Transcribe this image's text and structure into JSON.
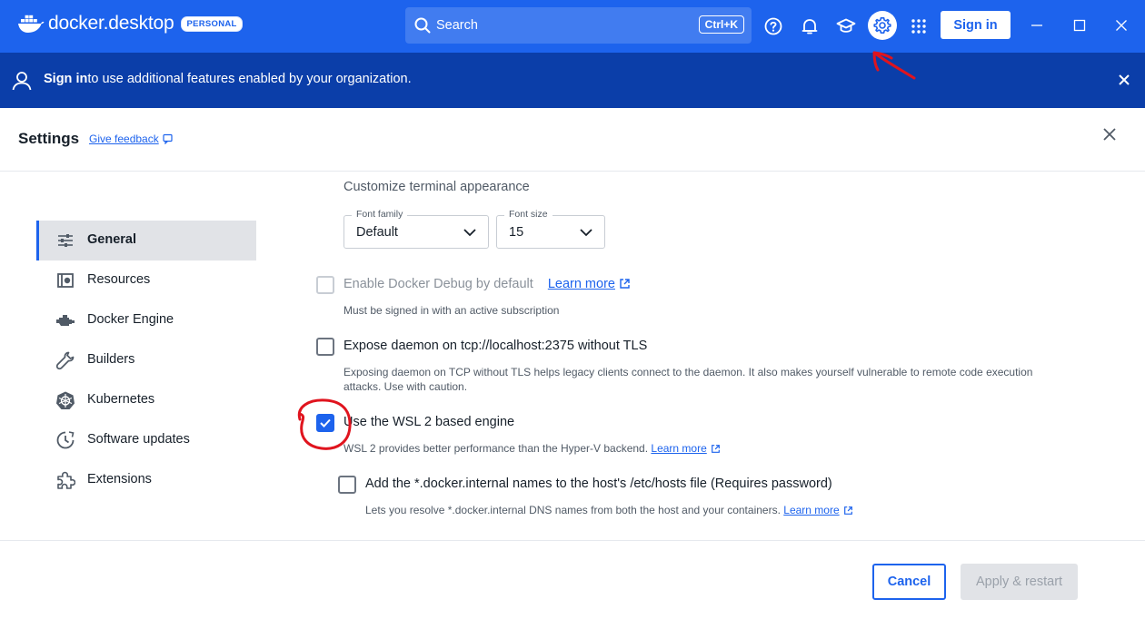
{
  "app": {
    "brand": "docker.desktop",
    "badge": "PERSONAL"
  },
  "topbar": {
    "search_label": "Search",
    "search_shortcut": "Ctrl+K",
    "signin_label": "Sign in",
    "icons": [
      "help-icon",
      "bell-icon",
      "learn-icon",
      "gear-icon",
      "apps-grid-icon"
    ]
  },
  "banner": {
    "signin_link": "Sign in",
    "message": "to use additional features enabled by your organization."
  },
  "settings": {
    "title": "Settings",
    "feedback_label": "Give feedback"
  },
  "sidebar": {
    "items": [
      {
        "label": "General",
        "icon": "sliders-icon",
        "active": true
      },
      {
        "label": "Resources",
        "icon": "resources-icon"
      },
      {
        "label": "Docker Engine",
        "icon": "engine-icon"
      },
      {
        "label": "Builders",
        "icon": "wrench-icon"
      },
      {
        "label": "Kubernetes",
        "icon": "kubernetes-icon"
      },
      {
        "label": "Software updates",
        "icon": "update-clock-icon"
      },
      {
        "label": "Extensions",
        "icon": "puzzle-icon"
      }
    ]
  },
  "general": {
    "terminal_section": "Customize terminal appearance",
    "font_family": {
      "label": "Font family",
      "value": "Default"
    },
    "font_size": {
      "label": "Font size",
      "value": "15"
    },
    "debug": {
      "label": "Enable Docker Debug by default",
      "link": "Learn more",
      "help": "Must be signed in with an active subscription",
      "checked": false,
      "disabled": true
    },
    "expose_daemon": {
      "label": "Expose daemon on tcp://localhost:2375 without TLS",
      "help": "Exposing daemon on TCP without TLS helps legacy clients connect to the daemon. It also makes yourself vulnerable to remote code execution attacks. Use with caution.",
      "checked": false
    },
    "wsl2": {
      "label": "Use the WSL 2 based engine",
      "help": "WSL 2 provides better performance than the Hyper-V backend.",
      "link": "Learn more",
      "checked": true
    },
    "hosts_file": {
      "label": "Add the *.docker.internal names to the host's /etc/hosts file (Requires password)",
      "help": "Lets you resolve *.docker.internal DNS names from both the host and your containers.",
      "link": "Learn more",
      "checked": false
    }
  },
  "footer": {
    "cancel_label": "Cancel",
    "apply_label": "Apply & restart"
  },
  "colors": {
    "titlebar": "#1d63ed",
    "banner": "#0b3ea9",
    "accent": "#1d63ed",
    "annotation": "#e0141e"
  }
}
